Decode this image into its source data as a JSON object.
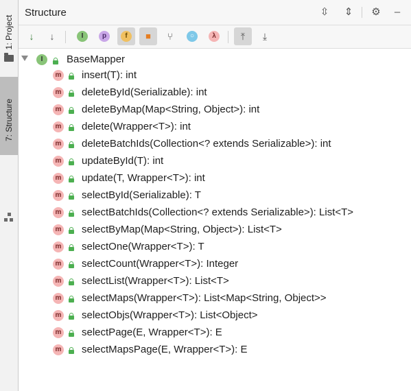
{
  "sidebar": {
    "project_label": "1: Project",
    "structure_label": "7: Structure"
  },
  "panel": {
    "title": "Structure"
  },
  "toolbar": {
    "icons": [
      "sort-by-visibility-icon",
      "sort-alphabetically-icon",
      "show-inherited-icon",
      "show-properties-icon",
      "show-fields-icon",
      "show-non-public-icon",
      "show-lambdas-icon",
      "show-anonymous-icon",
      "lambda-icon",
      "autoscroll-to-source-icon",
      "autoscroll-from-source-icon"
    ],
    "inherited_glyph": "I",
    "properties_glyph": "p",
    "fields_glyph": "f",
    "anonymous_glyph": "λ"
  },
  "tree": {
    "root": {
      "badge": "I",
      "label": "BaseMapper"
    },
    "method_badge": "m",
    "methods": [
      "insert(T): int",
      "deleteById(Serializable): int",
      "deleteByMap(Map<String, Object>): int",
      "delete(Wrapper<T>): int",
      "deleteBatchIds(Collection<? extends Serializable>): int",
      "updateById(T): int",
      "update(T, Wrapper<T>): int",
      "selectById(Serializable): T",
      "selectBatchIds(Collection<? extends Serializable>): List<T>",
      "selectByMap(Map<String, Object>): List<T>",
      "selectOne(Wrapper<T>): T",
      "selectCount(Wrapper<T>): Integer",
      "selectList(Wrapper<T>): List<T>",
      "selectMaps(Wrapper<T>): List<Map<String, Object>>",
      "selectObjs(Wrapper<T>): List<Object>",
      "selectPage(E, Wrapper<T>): E",
      "selectMapsPage(E, Wrapper<T>): E"
    ]
  },
  "colors": {
    "interface_badge": "#89c478",
    "method_badge": "#f5b5b5",
    "lock": "#4caf50",
    "active_tab": "#bdbdbd"
  }
}
